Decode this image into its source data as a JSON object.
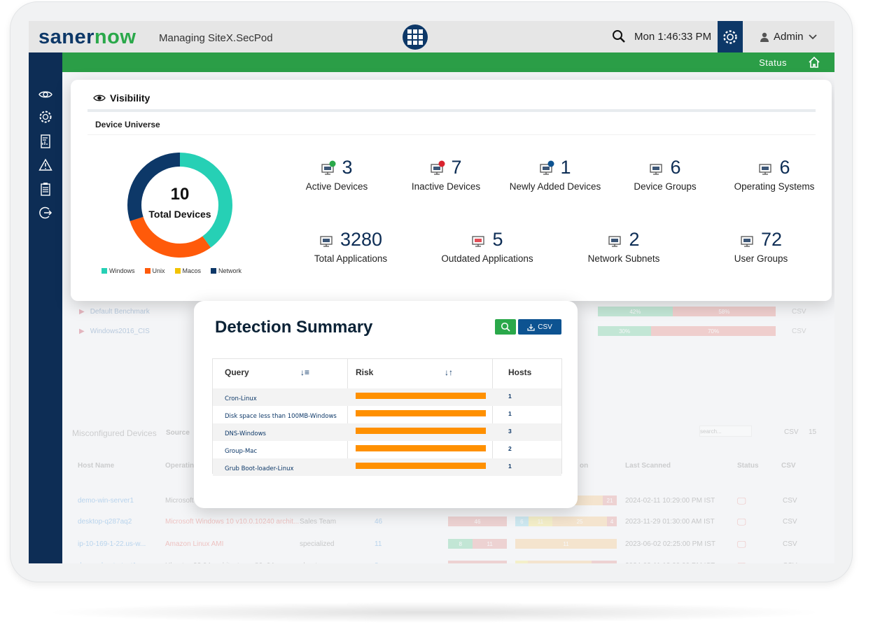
{
  "header": {
    "logo_a": "saner",
    "logo_b": "now",
    "managing": "Managing SiteX.SecPod",
    "time": "Mon 1:46:33 PM",
    "user": "Admin"
  },
  "statusbar": {
    "status": "Status"
  },
  "sidebar": {
    "items": [
      "visibility-icon",
      "settings-icon",
      "reports-icon",
      "alerts-icon",
      "tasks-icon",
      "logout-icon"
    ]
  },
  "visibility": {
    "title": "Visibility",
    "section": "Device Universe",
    "donut": {
      "total": "10",
      "label": "Total Devices",
      "segments": [
        {
          "name": "Windows",
          "value": 4,
          "color": "#26d0b5"
        },
        {
          "name": "Unix",
          "value": 3,
          "color": "#ff5a0a"
        },
        {
          "name": "Macos",
          "value": 0,
          "color": "#f2c300"
        },
        {
          "name": "Network",
          "value": 3,
          "color": "#0d3868"
        }
      ]
    },
    "stats": [
      {
        "value": "3",
        "label": "Active Devices",
        "icon": "active-devices-icon"
      },
      {
        "value": "7",
        "label": "Inactive Devices",
        "icon": "inactive-devices-icon"
      },
      {
        "value": "1",
        "label": "Newly Added Devices",
        "icon": "new-devices-icon"
      },
      {
        "value": "6",
        "label": "Device Groups",
        "icon": "device-groups-icon"
      },
      {
        "value": "6",
        "label": "Operating Systems",
        "icon": "operating-systems-icon"
      },
      {
        "value": "3280",
        "label": "Total Applications",
        "icon": "applications-icon"
      },
      {
        "value": "5",
        "label": "Outdated Applications",
        "icon": "outdated-applications-icon"
      },
      {
        "value": "2",
        "label": "Network Subnets",
        "icon": "network-subnets-icon"
      },
      {
        "value": "72",
        "label": "User Groups",
        "icon": "user-groups-icon"
      }
    ]
  },
  "benchmarks": [
    {
      "name": "Default Benchmark",
      "pass": "42%",
      "fail": "58%",
      "pass_pct": 42,
      "csv": "CSV"
    },
    {
      "name": "Windows2016_CIS",
      "pass": "30%",
      "fail": "70%",
      "pass_pct": 30,
      "csv": "CSV"
    }
  ],
  "misconfigured": {
    "title": "Misconfigured Devices",
    "source": "Source",
    "search_placeholder": "search...",
    "csv": "CSV",
    "page_size": "15",
    "headers": [
      "Host Name",
      "Operating System",
      "on",
      "Last Scanned",
      "Status",
      "CSV"
    ],
    "rows": [
      {
        "host": "demo-win-server1",
        "os": "Microsoft",
        "group": "",
        "count": "",
        "a": [],
        "b": [
          "131",
          "21"
        ],
        "scanned": "2024-02-11 10:29:00 PM IST"
      },
      {
        "host": "desktop-q287aq2",
        "os": "Microsoft Windows 10 v10.0.10240 archit...",
        "group": "Sales Team",
        "count": "46",
        "a": [
          "46"
        ],
        "b": [
          "6",
          "11",
          "25",
          "4"
        ],
        "scanned": "2023-11-29 01:30:00 AM IST"
      },
      {
        "host": "ip-10-169-1-22.us-w...",
        "os": "Amazon Linux AMI",
        "group": "specialized",
        "count": "11",
        "a": [
          "8",
          "11"
        ],
        "b": [
          "11"
        ],
        "scanned": "2023-06-02 02:25:00 PM IST"
      },
      {
        "host": "demo-ubuntu-test1",
        "os": "Ubuntu v22.04 architecture x86_64",
        "group": "ubuntu",
        "count": "8",
        "a": [
          "8"
        ],
        "b": [
          "1",
          "5",
          "2"
        ],
        "scanned": "2024-02-11 12:00:00 PM IST"
      }
    ]
  },
  "detection": {
    "title": "Detection Summary",
    "csv_label": "CSV",
    "headers": {
      "query": "Query",
      "risk": "Risk",
      "hosts": "Hosts"
    },
    "rows": [
      {
        "query": "Cron-Linux",
        "risk": "high",
        "hosts": "1"
      },
      {
        "query": "Disk space less than 100MB-Windows",
        "risk": "high",
        "hosts": "1"
      },
      {
        "query": "DNS-Windows",
        "risk": "high",
        "hosts": "3"
      },
      {
        "query": "Group-Mac",
        "risk": "high",
        "hosts": "2"
      },
      {
        "query": "Grub Boot-loader-Linux",
        "risk": "high",
        "hosts": "1"
      }
    ],
    "risk_color": "#ff9000"
  }
}
